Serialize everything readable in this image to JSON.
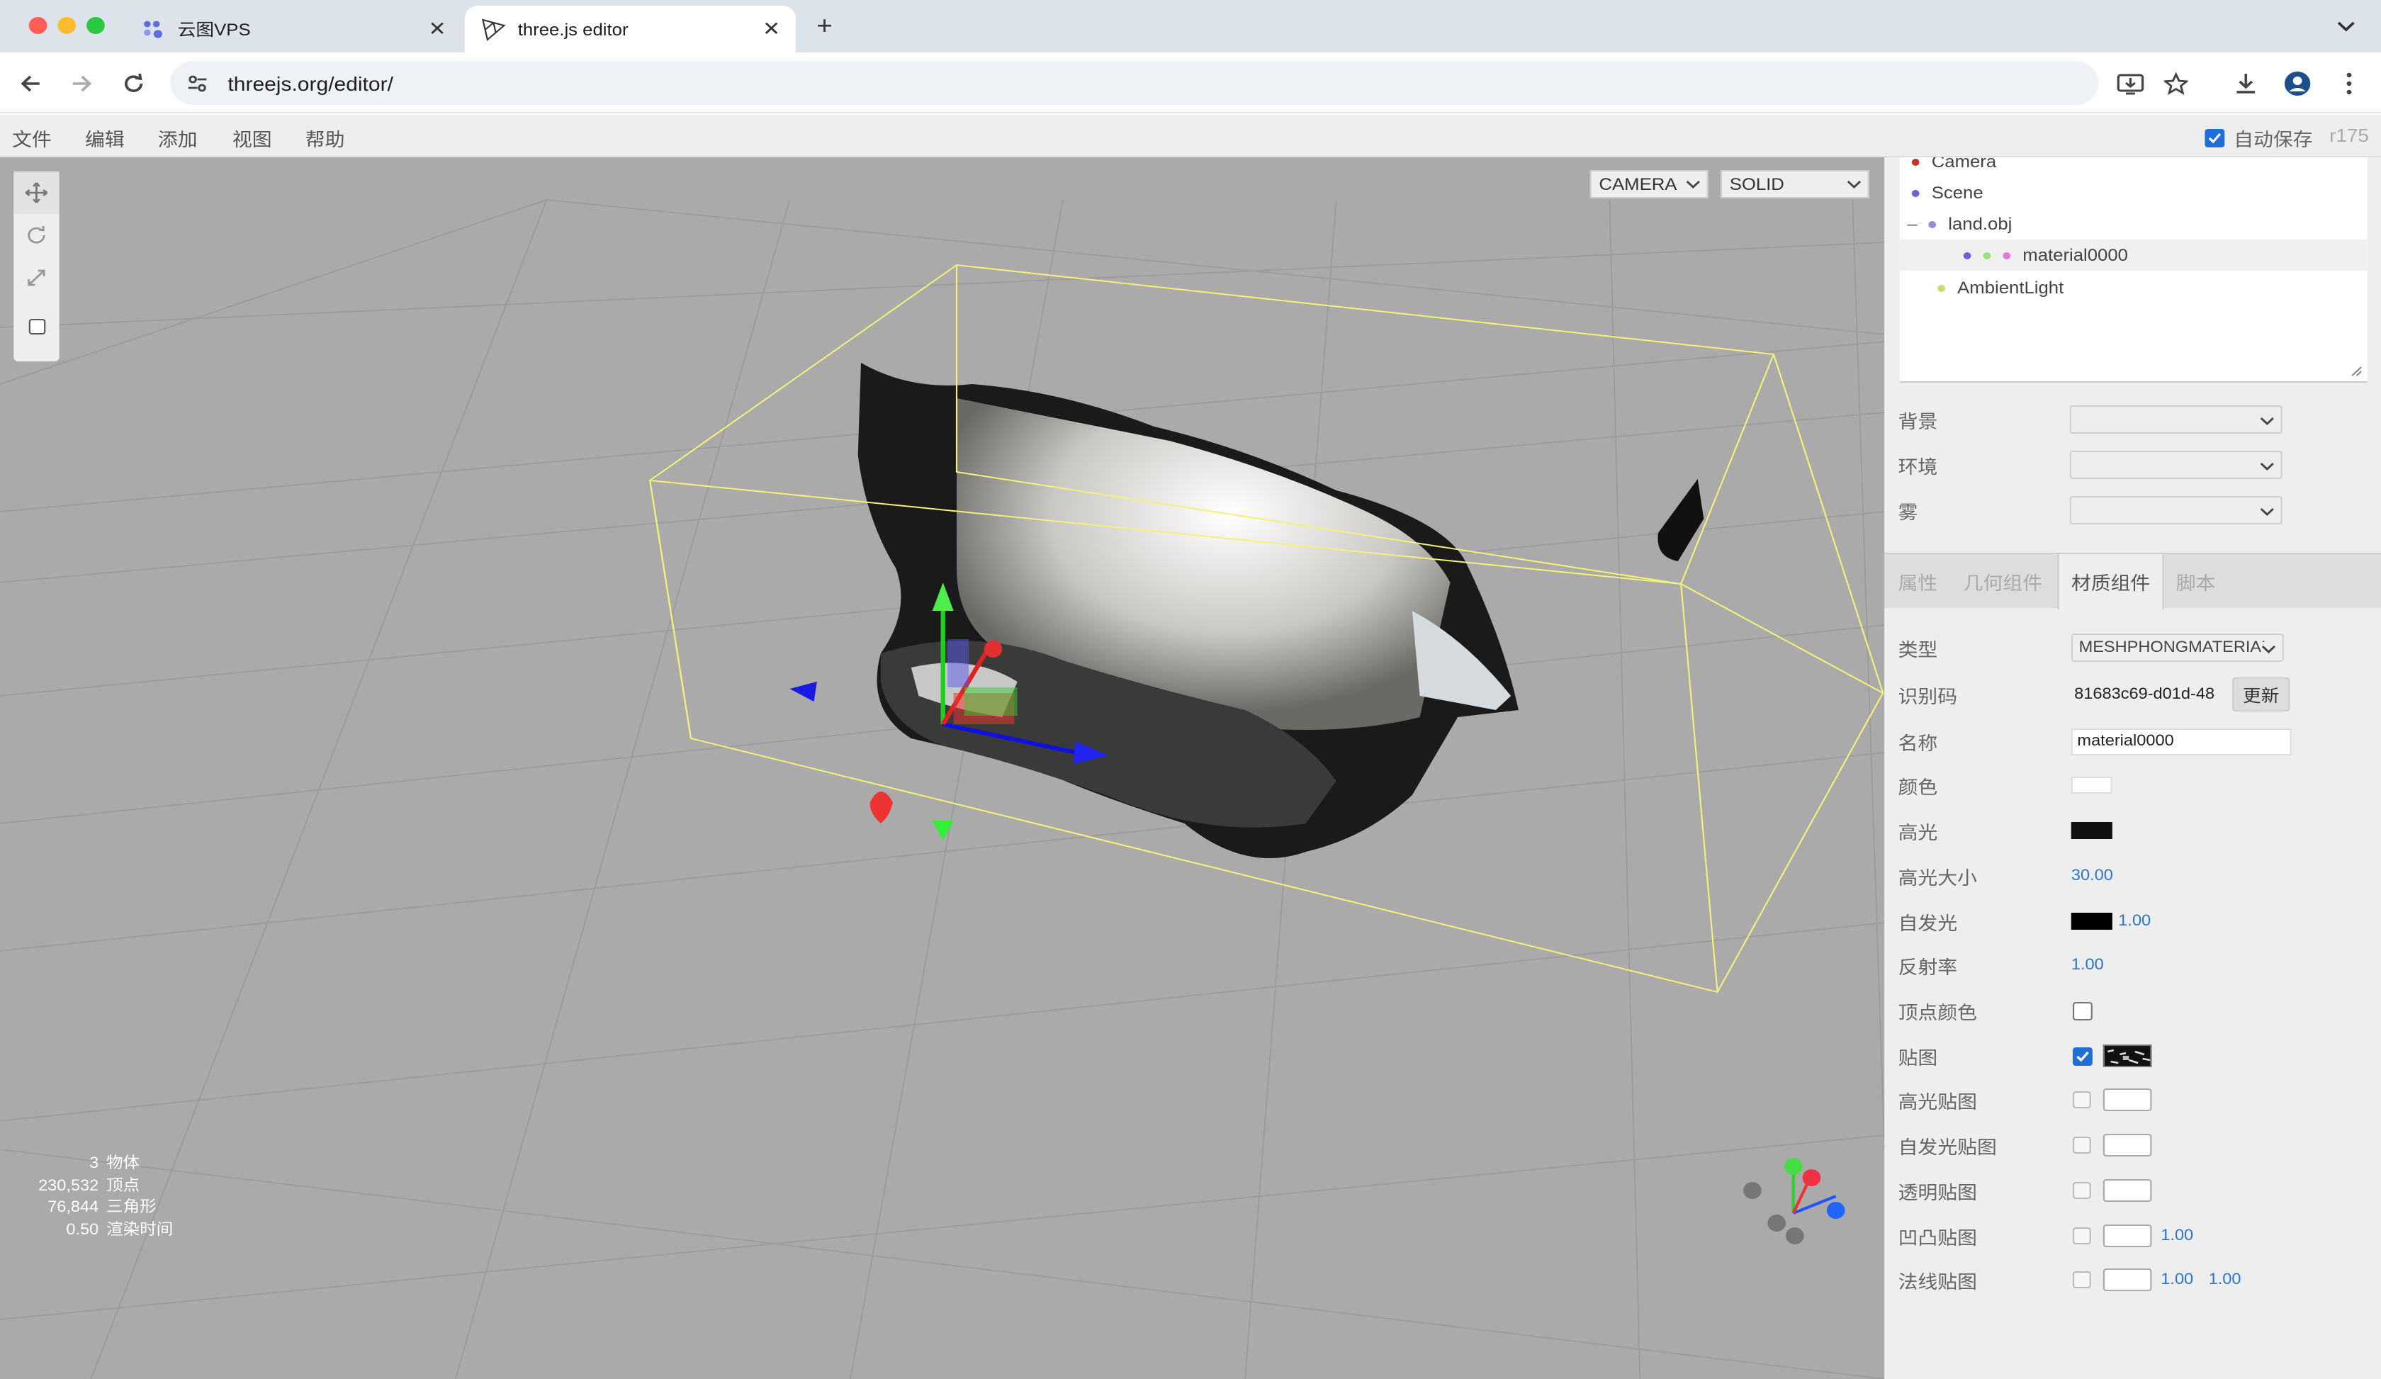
{
  "browser": {
    "tabs": [
      {
        "title": "云图VPS",
        "active": false
      },
      {
        "title": "three.js editor",
        "active": true
      }
    ],
    "url_host": "threejs.org",
    "url_path": "/editor/"
  },
  "menubar": {
    "items": [
      "文件",
      "编辑",
      "添加",
      "视图",
      "帮助"
    ],
    "autosave_label": "自动保存",
    "autosave_checked": true,
    "version": "r175"
  },
  "viewport": {
    "camera_select": "CAMERA",
    "shading_select": "SOLID",
    "info": [
      {
        "value": "3",
        "label": "物体"
      },
      {
        "value": "230,532",
        "label": "顶点"
      },
      {
        "value": "76,844",
        "label": "三角形"
      },
      {
        "value": "0.50",
        "label": "渲染时间"
      }
    ],
    "background_color": "#aaaaaa",
    "selection_box_color": "#ffff66"
  },
  "outliner": {
    "items": [
      {
        "name": "Camera",
        "dot": "#c0392b"
      },
      {
        "name": "Scene",
        "dot": "#7a5bd6"
      },
      {
        "name": "land.obj",
        "dot": "#9c88d8",
        "toggle": "–"
      },
      {
        "name": "material0000",
        "dots": [
          "#7a5bd6",
          "#9be07a",
          "#e07ad8"
        ],
        "selected": true
      },
      {
        "name": "AmbientLight",
        "dot": "#c9d873"
      }
    ]
  },
  "scene_props": {
    "background_label": "背景",
    "environment_label": "环境",
    "fog_label": "雾"
  },
  "sidebar_tabs": [
    "属性",
    "几何组件",
    "材质组件",
    "脚本"
  ],
  "material": {
    "type_label": "类型",
    "type_value": "MESHPHONGMATERIAL",
    "uuid_label": "识别码",
    "uuid_value": "81683c69-d01d-48",
    "update_label": "更新",
    "name_label": "名称",
    "name_value": "material0000",
    "color_label": "颜色",
    "color_value": "#ffffff",
    "specular_label": "高光",
    "specular_value": "#111111",
    "shininess_label": "高光大小",
    "shininess_value": "30.00",
    "emissive_label": "自发光",
    "emissive_color": "#000000",
    "emissive_intensity": "1.00",
    "reflectivity_label": "反射率",
    "reflectivity_value": "1.00",
    "vertex_colors_label": "顶点颜色",
    "map_label": "贴图",
    "specular_map_label": "高光贴图",
    "emissive_map_label": "自发光贴图",
    "alpha_map_label": "透明贴图",
    "bump_map_label": "凹凸贴图",
    "bump_scale": "1.00",
    "normal_map_label": "法线贴图",
    "normal_scale_x": "1.00",
    "normal_scale_y": "1.00"
  }
}
